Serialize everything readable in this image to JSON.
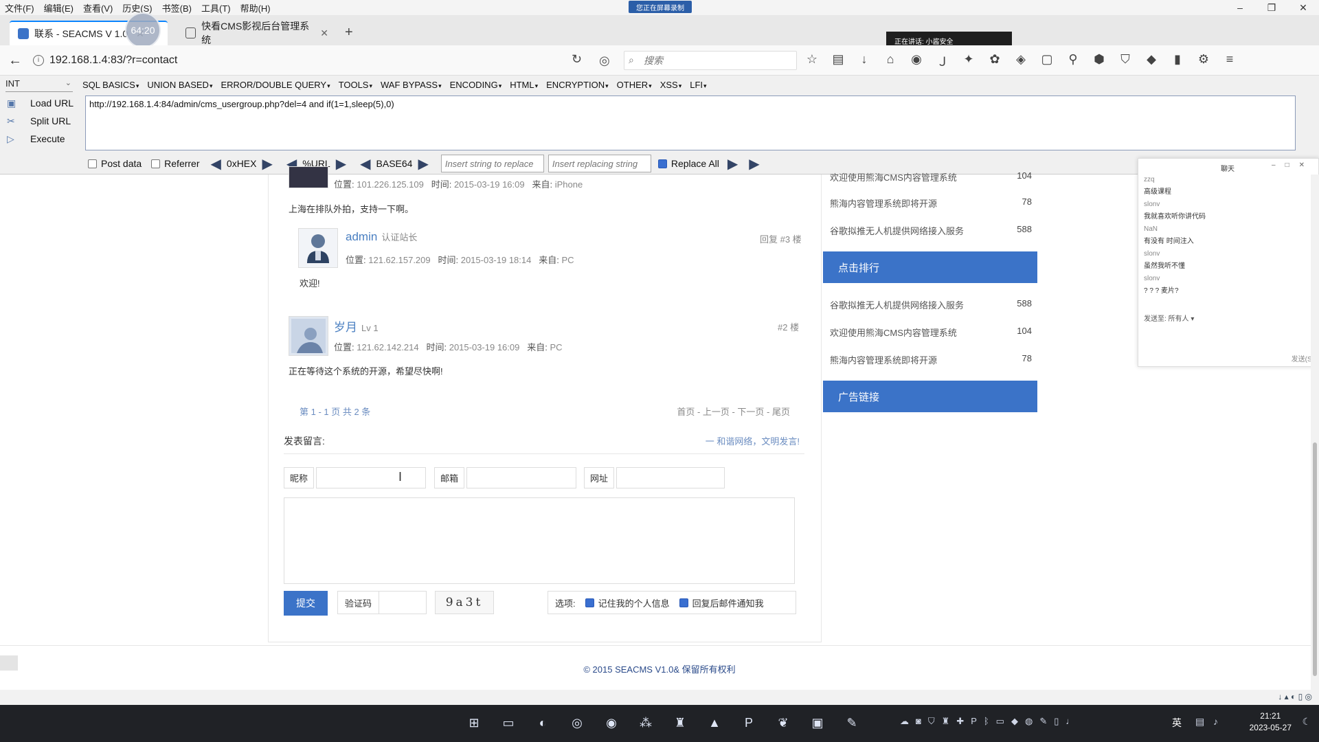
{
  "menubar": {
    "items": [
      "文件(F)",
      "编辑(E)",
      "查看(V)",
      "历史(S)",
      "书签(B)",
      "工具(T)",
      "帮助(H)"
    ],
    "recording_badge": "您正在屏幕录制"
  },
  "tabs": [
    {
      "label": "联系 - SEACMS V 1.0",
      "active": true
    },
    {
      "label": "快看CMS影视后台管理系统",
      "active": false
    }
  ],
  "timer": "64:20",
  "speaking_notice": "正在讲话: 小酱安全",
  "address": {
    "url": "192.168.1.4:83/?r=contact"
  },
  "search": {
    "placeholder": "搜索"
  },
  "hackbar": {
    "type_select": "INT",
    "menu": [
      "SQL BASICS",
      "UNION BASED",
      "ERROR/DOUBLE QUERY",
      "TOOLS",
      "WAF BYPASS",
      "ENCODING",
      "HTML",
      "ENCRYPTION",
      "OTHER",
      "XSS",
      "LFI"
    ],
    "load_url": "Load URL",
    "split_url": "Split URL",
    "execute": "Execute",
    "url_value": "http://192.168.1.4:84/admin/cms_usergroup.php?del=4 and if(1=1,sleep(5),0)",
    "post_data": "Post data",
    "referrer": "Referrer",
    "hex": "0xHEX",
    "url_enc": "%URL",
    "base64": "BASE64",
    "insert_placeholder": "Insert string to replace",
    "replacing_placeholder": "Insert replacing string",
    "replace_all": "Replace All"
  },
  "comments": [
    {
      "location_label": "位置:",
      "ip": "101.226.125.109",
      "time_label": "时间:",
      "time": "2015-03-19 16:09",
      "from_label": "来自:",
      "from": "iPhone",
      "text": "上海在排队外拍，支持一下啊。"
    },
    {
      "user": "admin",
      "badge": "认证站长",
      "floor": "回复 #3 楼",
      "location_label": "位置:",
      "ip": "121.62.157.209",
      "time_label": "时间:",
      "time": "2015-03-19 18:14",
      "from_label": "来自:",
      "from": "PC",
      "text": "欢迎!"
    },
    {
      "user": "岁月",
      "badge": "Lv 1",
      "floor": "#2 楼",
      "location_label": "位置:",
      "ip": "121.62.142.214",
      "time_label": "时间:",
      "time": "2015-03-19 16:09",
      "from_label": "来自:",
      "from": "PC",
      "text": "正在等待这个系统的开源，希望尽快啊!"
    }
  ],
  "pager": {
    "info": "第 1 - 1 页 共 2 条",
    "links": "首页 - 上一页 - 下一页 - 尾页"
  },
  "post_form": {
    "title": "发表留言:",
    "slogan": "一 和谐网络，文明发言!",
    "nickname_label": "昵称",
    "email_label": "邮箱",
    "website_label": "网址",
    "submit": "提交",
    "captcha_label": "验证码",
    "captcha_code": "9a3t",
    "options_label": "选项:",
    "remember": "记住我的个人信息",
    "notify": "回复后邮件通知我"
  },
  "sidebar": {
    "top_items": [
      {
        "title": "欢迎使用熊海CMS内容管理系统",
        "count": "104"
      },
      {
        "title": "熊海内容管理系统即将开源",
        "count": "78"
      },
      {
        "title": "谷歌拟推无人机提供网络接入服务",
        "count": "588"
      }
    ],
    "rank_title": "点击排行",
    "rank_items": [
      {
        "title": "谷歌拟推无人机提供网络接入服务",
        "count": "588"
      },
      {
        "title": "欢迎使用熊海CMS内容管理系统",
        "count": "104"
      },
      {
        "title": "熊海内容管理系统即将开源",
        "count": "78"
      }
    ],
    "ad_title": "广告链接"
  },
  "footer": "© 2015 SEACMS V1.0& 保留所有权利",
  "chat": {
    "title": "聊天",
    "messages": [
      {
        "who": "zzq",
        "text": "高级课程"
      },
      {
        "who": "slonv",
        "text": "我就喜欢听你讲代码"
      },
      {
        "who": "NaN",
        "text": "有没有 时间注入"
      },
      {
        "who": "slonv",
        "text": "虽然我听不懂"
      },
      {
        "who": "slonv",
        "text": "? ? ? 麦片?"
      }
    ],
    "send_to": "发送至:  所有人 ▾",
    "send_btn": "发送(S)"
  },
  "taskbar": {
    "time": "21:21",
    "date": "2023-05-27",
    "lang": "英"
  }
}
